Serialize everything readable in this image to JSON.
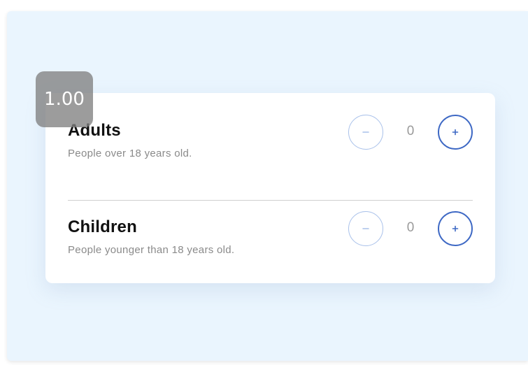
{
  "zoom_level": "1.00",
  "rows": [
    {
      "title": "Adults",
      "subtitle": "People over 18 years old.",
      "count": "0"
    },
    {
      "title": "Children",
      "subtitle": "People younger than 18 years old.",
      "count": "0"
    }
  ],
  "icons": {
    "decrement": "minus-icon",
    "increment": "plus-icon"
  },
  "colors": {
    "background": "#eaf5fe",
    "card": "#ffffff",
    "accent": "#3d68c4",
    "accent_light": "#a9c1ea",
    "title_text": "#111111",
    "subtitle_text": "#8a8a8a"
  }
}
